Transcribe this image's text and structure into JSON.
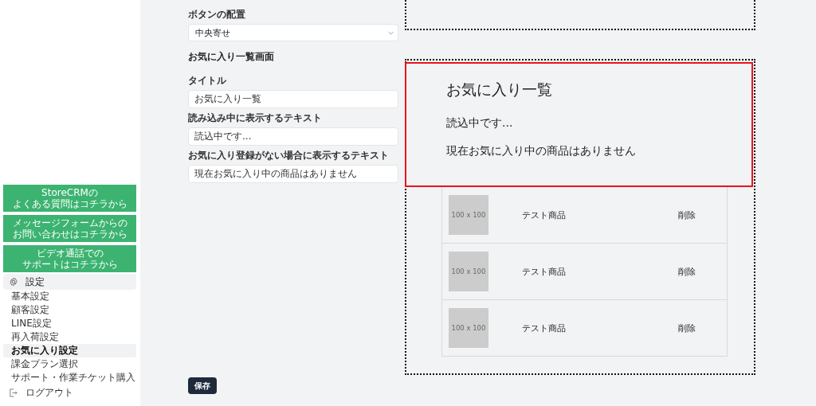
{
  "sidebar": {
    "help_buttons": [
      {
        "lines": [
          "StoreCRMの",
          "よくある質問はコチラから"
        ]
      },
      {
        "lines": [
          "メッセージフォームからの",
          "お問い合わせはコチラから"
        ]
      },
      {
        "lines": [
          "ビデオ通話での",
          "サポートはコチラから"
        ]
      }
    ],
    "section": {
      "title": "設定",
      "expanded": true
    },
    "items": [
      {
        "label": "基本設定",
        "selected": false
      },
      {
        "label": "顧客設定",
        "selected": false
      },
      {
        "label": "LINE設定",
        "selected": false
      },
      {
        "label": "再入荷設定",
        "selected": false
      },
      {
        "label": "お気に入り設定",
        "selected": true
      },
      {
        "label": "課金プラン選択",
        "selected": false
      },
      {
        "label": "サポート・作業チケット購入",
        "selected": false
      }
    ],
    "logout": "ログアウト"
  },
  "form": {
    "button_alignment": {
      "label": "ボタンの配置",
      "value": "中央寄せ"
    },
    "section_heading": "お気に入り一覧画面",
    "fields": [
      {
        "label": "タイトル",
        "value": "お気に入り一覧"
      },
      {
        "label": "読み込み中に表示するテキスト",
        "value": "読込中です..."
      },
      {
        "label": "お気に入り登録がない場合に表示するテキスト",
        "value": "現在お気に入り中の商品はありません"
      }
    ],
    "save": "保存"
  },
  "preview": {
    "title": "お気に入り一覧",
    "loading": "読込中です...",
    "empty": "現在お気に入り中の商品はありません",
    "items": [
      {
        "image_label": "100 x 100",
        "name": "テスト商品",
        "action": "削除"
      },
      {
        "image_label": "100 x 100",
        "name": "テスト商品",
        "action": "削除"
      },
      {
        "image_label": "100 x 100",
        "name": "テスト商品",
        "action": "削除"
      }
    ]
  }
}
